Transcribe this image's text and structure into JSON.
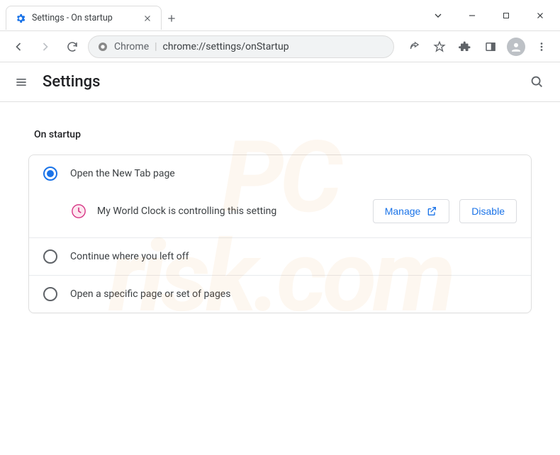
{
  "window": {
    "tab_title": "Settings - On startup"
  },
  "toolbar": {
    "chrome_label": "Chrome",
    "url": "chrome://settings/onStartup"
  },
  "header": {
    "title": "Settings"
  },
  "section": {
    "title": "On startup",
    "options": {
      "new_tab": "Open the New Tab page",
      "continue": "Continue where you left off",
      "specific": "Open a specific page or set of pages"
    },
    "extension_notice": "My World Clock is controlling this setting",
    "buttons": {
      "manage": "Manage",
      "disable": "Disable"
    }
  },
  "watermark": {
    "line1": "PC",
    "line2": "risk.com"
  }
}
